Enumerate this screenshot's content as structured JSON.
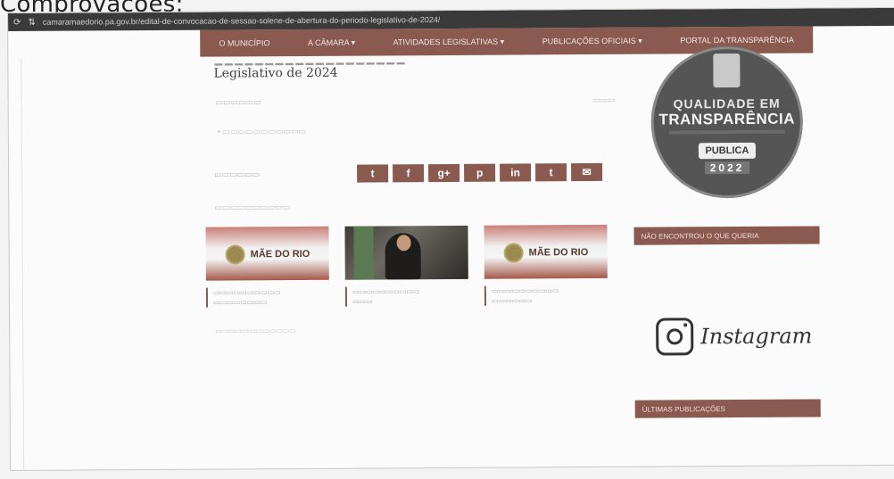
{
  "caption": "Comprovações:",
  "browser": {
    "url": "camaramaedorio.pa.gov.br/edital-de-convocacao-de-sessao-solene-de-abertura-do-periodo-legislativo-de-2024/"
  },
  "nav": {
    "items": [
      "O MUNICÍPIO",
      "A CÂMARA ▾",
      "ATIVIDADES LEGISLATIVAS ▾",
      "PUBLICAÇÕES OFICIAIS ▾",
      "PORTAL DA TRANSPARÊNCIA"
    ]
  },
  "article": {
    "title_line2": "Legislativo de 2024"
  },
  "share": {
    "buttons": [
      "t",
      "f",
      "g+",
      "p",
      "in",
      "t",
      "✉"
    ]
  },
  "related": {
    "cards": [
      {
        "logo_text": "MÃE DO RIO"
      },
      {
        "logo_text": ""
      },
      {
        "logo_text": "MÃE DO RIO"
      }
    ]
  },
  "sidebar": {
    "badge": {
      "line1": "QUALIDADE EM",
      "line2": "TRANSPARÊNCIA",
      "publica": "PUBLICA",
      "year": "2022"
    },
    "section1": "NÃO ENCONTROU O QUE QUERIA",
    "instagram": "Instagram",
    "section2": "ÚLTIMAS PUBLICAÇÕES"
  }
}
